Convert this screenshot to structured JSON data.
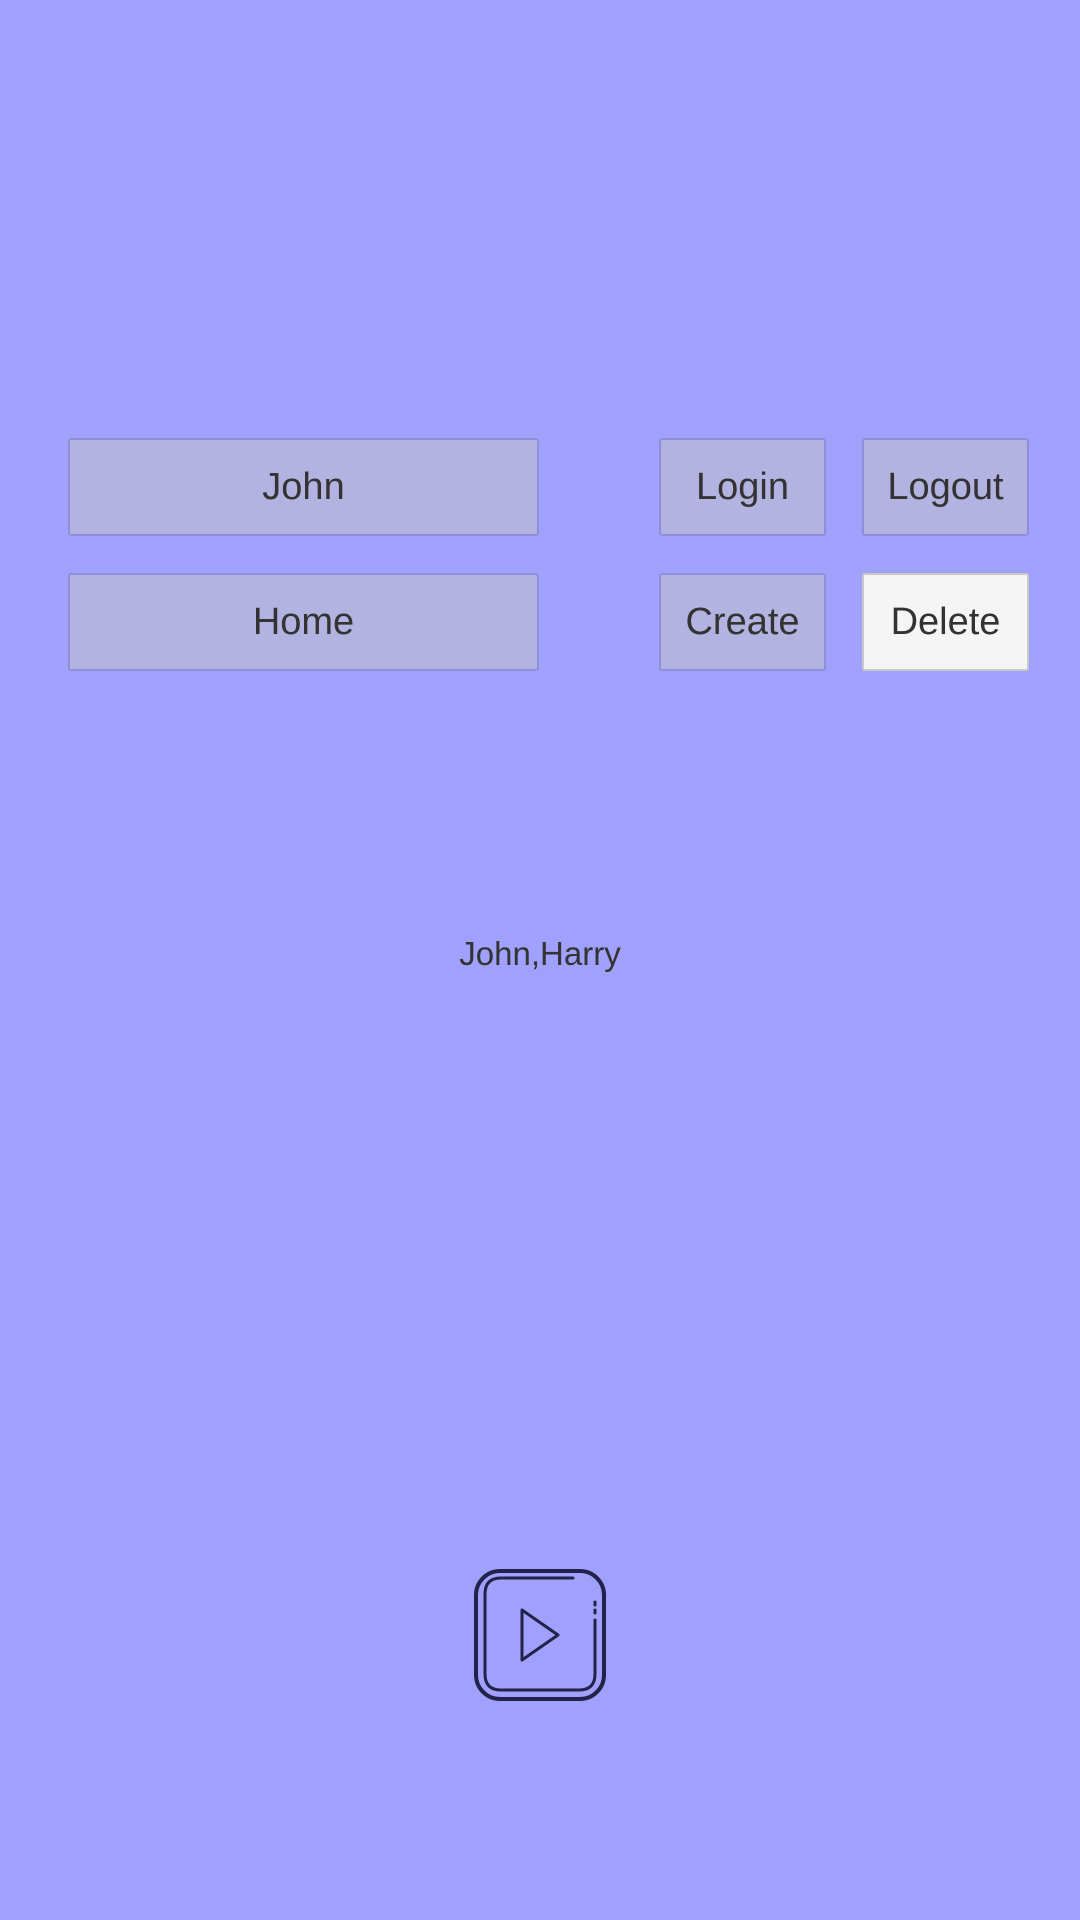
{
  "buttons": {
    "john": "John",
    "home": "Home",
    "login": "Login",
    "create": "Create",
    "logout": "Logout",
    "delete": "Delete"
  },
  "names_text": "John,Harry",
  "icons": {
    "play": "play-icon"
  },
  "colors": {
    "background": "#a0a1fd",
    "button": "#b3b3e1",
    "button_active": "#f5f5f5",
    "text": "#333333"
  }
}
